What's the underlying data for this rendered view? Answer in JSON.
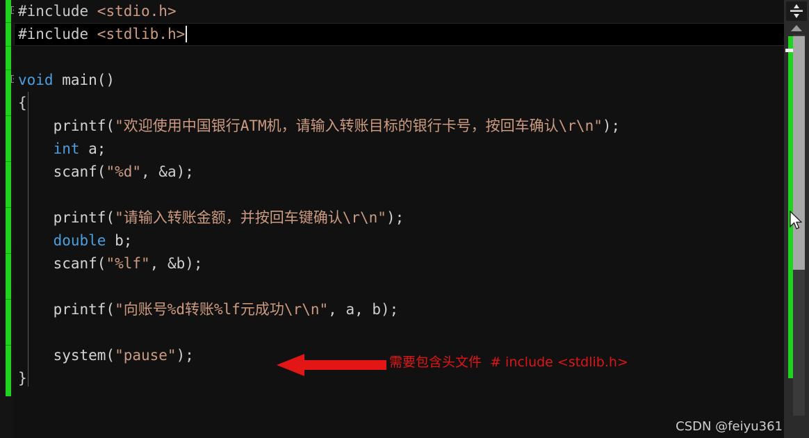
{
  "editor": {
    "language": "c",
    "colors": {
      "background": "#111111",
      "gutter": "#141414",
      "changebar_green": "#1fd31f",
      "keyword_blue": "#4a9fe0",
      "string_salmon": "#cd9b7f",
      "plain_text": "#d6d6d6",
      "scrollbar_thumb": "#a8a8a8",
      "annotation_red": "#e01414"
    },
    "lines": [
      {
        "n": 1,
        "fold": true,
        "highlight": false,
        "tokens": [
          {
            "cls": "tok-pre",
            "text": "#include "
          },
          {
            "cls": "tok-inc",
            "text": "<stdio.h>"
          }
        ]
      },
      {
        "n": 2,
        "fold": false,
        "highlight": true,
        "caret": true,
        "tokens": [
          {
            "cls": "tok-pre",
            "text": "#include "
          },
          {
            "cls": "tok-inc",
            "text": "<stdlib.h>"
          }
        ]
      },
      {
        "n": 3,
        "fold": false,
        "highlight": false,
        "tokens": []
      },
      {
        "n": 4,
        "fold": true,
        "highlight": false,
        "tokens": [
          {
            "cls": "tok-kw",
            "text": "void"
          },
          {
            "cls": "tok-fn",
            "text": " main()"
          }
        ]
      },
      {
        "n": 5,
        "fold": false,
        "highlight": false,
        "tokens": [
          {
            "cls": "tok-pun",
            "text": "{"
          }
        ]
      },
      {
        "n": 6,
        "fold": false,
        "highlight": false,
        "tokens": [
          {
            "cls": "tok-fn",
            "text": "    printf("
          },
          {
            "cls": "tok-str",
            "text": "\"欢迎使用中国银行ATM机，请输入转账目标的银行卡号，按回车确认\\r\\n\""
          },
          {
            "cls": "tok-pun",
            "text": ");"
          }
        ]
      },
      {
        "n": 7,
        "fold": false,
        "highlight": false,
        "tokens": [
          {
            "cls": "tok-kw",
            "text": "    int"
          },
          {
            "cls": "tok-var",
            "text": " a;"
          }
        ]
      },
      {
        "n": 8,
        "fold": false,
        "highlight": false,
        "tokens": [
          {
            "cls": "tok-fn",
            "text": "    scanf("
          },
          {
            "cls": "tok-str",
            "text": "\"%d\""
          },
          {
            "cls": "tok-pun",
            "text": ", &a);"
          }
        ]
      },
      {
        "n": 9,
        "fold": false,
        "highlight": false,
        "tokens": []
      },
      {
        "n": 10,
        "fold": false,
        "highlight": false,
        "tokens": [
          {
            "cls": "tok-fn",
            "text": "    printf("
          },
          {
            "cls": "tok-str",
            "text": "\"请输入转账金额，并按回车键确认\\r\\n\""
          },
          {
            "cls": "tok-pun",
            "text": ");"
          }
        ]
      },
      {
        "n": 11,
        "fold": false,
        "highlight": false,
        "tokens": [
          {
            "cls": "tok-kw",
            "text": "    double"
          },
          {
            "cls": "tok-var",
            "text": " b;"
          }
        ]
      },
      {
        "n": 12,
        "fold": false,
        "highlight": false,
        "tokens": [
          {
            "cls": "tok-fn",
            "text": "    scanf("
          },
          {
            "cls": "tok-str",
            "text": "\"%lf\""
          },
          {
            "cls": "tok-pun",
            "text": ", &b);"
          }
        ]
      },
      {
        "n": 13,
        "fold": false,
        "highlight": false,
        "tokens": []
      },
      {
        "n": 14,
        "fold": false,
        "highlight": false,
        "tokens": [
          {
            "cls": "tok-fn",
            "text": "    printf("
          },
          {
            "cls": "tok-str",
            "text": "\"向账号%d转账%lf元成功\\r\\n\""
          },
          {
            "cls": "tok-pun",
            "text": ", a, b);"
          }
        ]
      },
      {
        "n": 15,
        "fold": false,
        "highlight": false,
        "tokens": []
      },
      {
        "n": 16,
        "fold": false,
        "highlight": false,
        "tokens": [
          {
            "cls": "tok-fn",
            "text": "    system("
          },
          {
            "cls": "tok-str",
            "text": "\"pause\""
          },
          {
            "cls": "tok-pun",
            "text": ");"
          }
        ]
      },
      {
        "n": 17,
        "fold": false,
        "highlight": false,
        "tokens": [
          {
            "cls": "tok-pun",
            "text": "}"
          }
        ]
      }
    ]
  },
  "annotation": {
    "arrow_icon": "left-arrow-icon",
    "text": "需要包含头文件  # include <stdlib.h>"
  },
  "scrollbar": {
    "split_icon": "split-editor-icon",
    "up_arrow_icon": "scroll-up-arrow-icon",
    "cursor_icon": "mouse-pointer-icon"
  },
  "watermark": {
    "text": "CSDN @feiyu361"
  }
}
